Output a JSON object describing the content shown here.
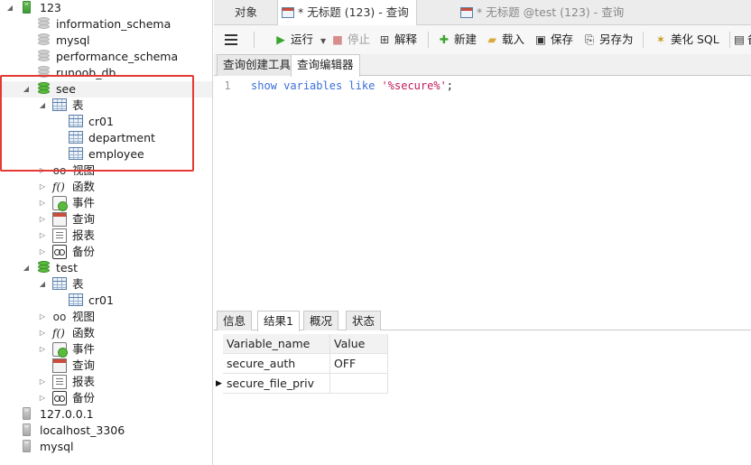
{
  "navigator": {
    "rows": [
      {
        "label": "123",
        "icon": "server-icon"
      },
      {
        "label": "information_schema",
        "icon": "database-icon"
      },
      {
        "label": "mysql",
        "icon": "database-icon"
      },
      {
        "label": "performance_schema",
        "icon": "database-icon"
      },
      {
        "label": "runoob_db",
        "icon": "database-icon"
      },
      {
        "label": "see",
        "icon": "database-icon"
      },
      {
        "label": "表",
        "icon": "table-icon"
      },
      {
        "label": "cr01",
        "icon": "table-icon"
      },
      {
        "label": "department",
        "icon": "table-icon"
      },
      {
        "label": "employee",
        "icon": "table-icon"
      },
      {
        "label": "视图",
        "icon": "view-icon"
      },
      {
        "label": "函数",
        "icon": "function-icon"
      },
      {
        "label": "事件",
        "icon": "event-icon"
      },
      {
        "label": "查询",
        "icon": "query-icon"
      },
      {
        "label": "报表",
        "icon": "report-icon"
      },
      {
        "label": "备份",
        "icon": "backup-icon"
      },
      {
        "label": "test",
        "icon": "database-icon"
      },
      {
        "label": "表",
        "icon": "table-icon"
      },
      {
        "label": "cr01",
        "icon": "table-icon"
      },
      {
        "label": "视图",
        "icon": "view-icon"
      },
      {
        "label": "函数",
        "icon": "function-icon"
      },
      {
        "label": "事件",
        "icon": "event-icon"
      },
      {
        "label": "查询",
        "icon": "query-icon"
      },
      {
        "label": "报表",
        "icon": "report-icon"
      },
      {
        "label": "备份",
        "icon": "backup-icon"
      },
      {
        "label": "127.0.0.1",
        "icon": "server-icon"
      },
      {
        "label": "localhost_3306",
        "icon": "server-icon"
      },
      {
        "label": "mysql",
        "icon": "server-icon"
      }
    ]
  },
  "tabs": {
    "objects": "对象",
    "query_active": "* 无标题 (123) - 查询",
    "query_inactive": "* 无标题 @test (123) - 查询"
  },
  "toolbar": {
    "run": "运行",
    "stop": "停止",
    "explain": "解释",
    "new": "新建",
    "load": "载入",
    "save": "保存",
    "save_as": "另存为",
    "beautify": "美化 SQL",
    "more": "备"
  },
  "subtabs": {
    "builder": "查询创建工具",
    "editor": "查询编辑器"
  },
  "editor": {
    "line_number": "1",
    "kw1": "show",
    "kw2": "variables",
    "kw3": "like",
    "pattern": "'%secure%'",
    "terminator": ";"
  },
  "result_tabs": {
    "info": "信息",
    "result1": "结果1",
    "profile": "概况",
    "status": "状态"
  },
  "grid": {
    "columns": [
      "Variable_name",
      "Value"
    ],
    "rows": [
      [
        "secure_auth",
        "OFF"
      ],
      [
        "secure_file_priv",
        ""
      ]
    ]
  },
  "colors": {
    "highlight_box": "#e53935",
    "keyword": "#3a6fd8",
    "string": "#c2185b"
  }
}
